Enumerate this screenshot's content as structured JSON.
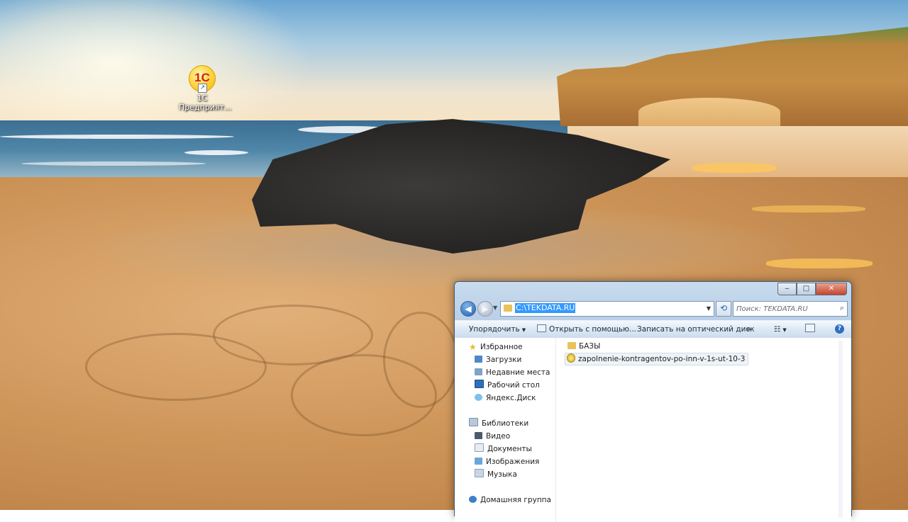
{
  "desktop": {
    "icons": [
      {
        "label_line1": "1С",
        "label_line2": "Предприят...",
        "logo_text": "1С"
      }
    ]
  },
  "window": {
    "caption_buttons": {
      "minimize": "‒",
      "maximize": "□",
      "close": "✕"
    },
    "nav": {
      "back_glyph": "◀",
      "forward_glyph": "▶"
    },
    "address": {
      "value": "C:\\TEKDATA.RU"
    },
    "search": {
      "placeholder": "Поиск: TEKDATA.RU"
    },
    "toolbar": {
      "organize": "Упорядочить",
      "open_with": "Открыть с помощью...",
      "burn": "Записать на оптический диск",
      "more": "»",
      "help": "?"
    },
    "navigation_pane": {
      "favorites": "Избранное",
      "downloads": "Загрузки",
      "recent_places": "Недавние места",
      "desktop": "Рабочий стол",
      "yandex_disk": "Яндекс.Диск",
      "libraries": "Библиотеки",
      "video": "Видео",
      "documents": "Документы",
      "images": "Изображения",
      "music": "Музыка",
      "homegroup": "Домашняя группа"
    },
    "files": [
      {
        "name": "БАЗЫ",
        "type": "folder"
      },
      {
        "name": "zapolnenie-kontragentov-po-inn-v-1s-ut-10-3",
        "type": "file"
      }
    ]
  },
  "colors": {
    "selection": "#3399ff",
    "window_frame": "#b7cde6",
    "logo_text": "#d21e1e"
  },
  "icons": {
    "back": "back-arrow-icon",
    "forward": "forward-arrow-icon",
    "search": "search-icon",
    "refresh": "refresh-icon",
    "help": "help-icon"
  }
}
